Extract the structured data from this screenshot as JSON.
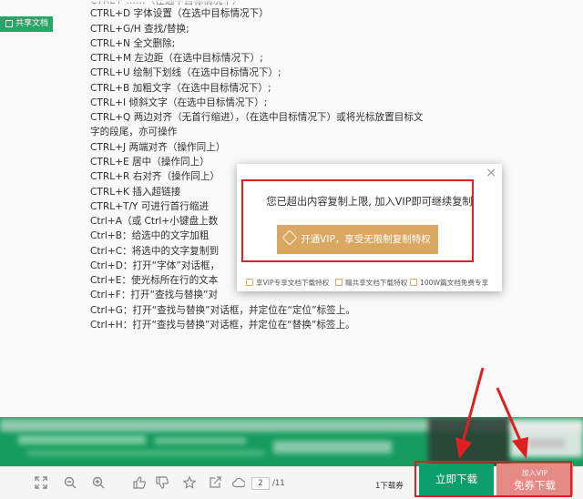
{
  "badge": {
    "label": "共享文档"
  },
  "doc_lines": [
    "CTRL+D 字体设置（在选中目标情况下）",
    "CTRL+G/H 查找/替换;",
    "CTRL+N 全文删除;",
    "CTRL+M 左边距（在选中目标情况下）;",
    "CTRL+U 绘制下划线（在选中目标情况下）;",
    "CTRL+B 加粗文字（在选中目标情况下）;",
    "CTRL+I 倾斜文字（在选中目标情况下）;",
    "CTRL+Q 两边对齐（无首行缩进），（在选中目标情况下）或将光标放置目标文",
    "字的段尾，亦可操作",
    "CTRL+J 两端对齐（操作同上）",
    "CTRL+E 居中（操作同上）",
    "CTRL+R 右对齐（操作同上）",
    "CTRL+K 插入超链接",
    "CTRL+T/Y 可进行首行缩进",
    "Ctrl+A（或 Ctrl+小键盘上数",
    "Ctrl+B：给选中的文字加粗",
    "Ctrl+C：将选中的文字复制到",
    "Ctrl+D：打开“字体”对话框，",
    "Ctrl+E：使光标所在行的文本",
    "Ctrl+F：打开“查找与替换”对",
    "Ctrl+G：打开“查找与替换”对话框，并定位在“定位”标签上。",
    "Ctrl+H：打开“查找与替换”对话框，并定位在“替换”标签上。"
  ],
  "modal": {
    "close": "×",
    "message": "您已超出内容复制上限, 加入VIP即可继续复制",
    "vip_button": "开通VIP，享受无限制复制特权",
    "perks": [
      "享VIP专享文档下载特权",
      "赠共享文档下载特权",
      "100W篇文档免费专享"
    ]
  },
  "toolbar": {
    "page_current": "2",
    "page_total": "/11",
    "download_note": "1下载券",
    "download_button": "立即下载",
    "vip_small": "加入VIP",
    "vip_big": "免券下载"
  },
  "colors": {
    "green": "#0fa46e",
    "gold": "#d9a760",
    "red_annotation": "#e02020",
    "vip_pink": "#ea8d88"
  }
}
